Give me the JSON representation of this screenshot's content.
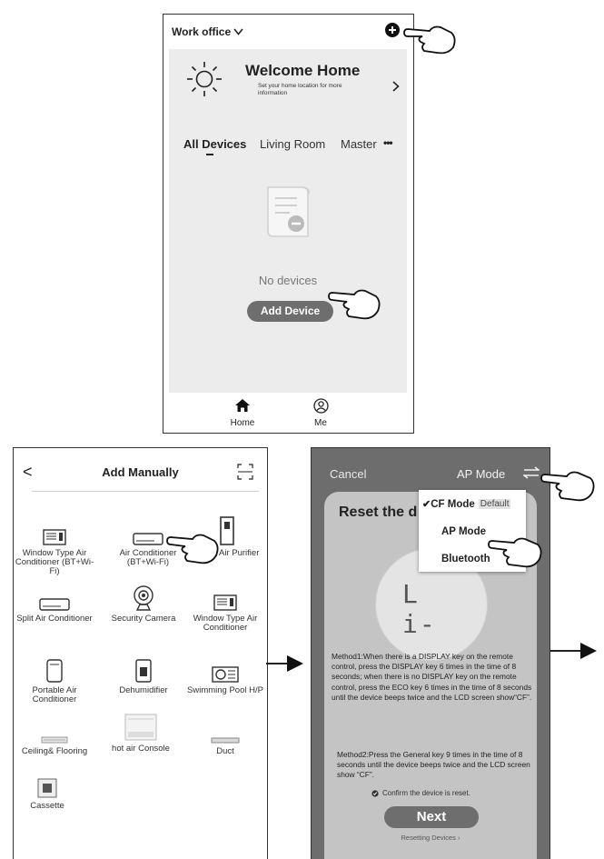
{
  "top_screen": {
    "location_label": "Work office",
    "welcome_title": "Welcome Home",
    "welcome_sub": "Set your home location for more information",
    "tabs": [
      "All Devices",
      "Living Room",
      "Master"
    ],
    "tab_more": "•••",
    "empty_text": "No devices",
    "add_device_label": "Add Device",
    "tabbar": [
      {
        "label": "Home",
        "icon": "home-icon"
      },
      {
        "label": "Me",
        "icon": "person-icon"
      }
    ]
  },
  "left_screen": {
    "back_glyph": "<",
    "title": "Add Manually",
    "devices": [
      {
        "label": "Window Type Air Conditioner (BT+Wi-Fi)",
        "icon": "window-ac-icon"
      },
      {
        "label": "Air Conditioner (BT+Wi-Fi)",
        "icon": "split-ac-icon"
      },
      {
        "label": "Fresh Air Purifier",
        "icon": "fresh-air-purifier-icon"
      },
      {
        "label": "Split Air Conditioner",
        "icon": "split-ac-icon"
      },
      {
        "label": "Security Camera",
        "icon": "camera-icon"
      },
      {
        "label": "Window Type Air Conditioner",
        "icon": "window-ac-icon"
      },
      {
        "label": "Portable Air Conditioner",
        "icon": "portable-ac-icon"
      },
      {
        "label": "Dehumidifier",
        "icon": "dehumidifier-icon"
      },
      {
        "label": "Swimming Pool H/P",
        "icon": "pool-heatpump-icon"
      },
      {
        "label": "Ceiling& Flooring",
        "icon": "ceiling-unit-icon"
      },
      {
        "label": "hot air Console",
        "icon": "console-icon"
      },
      {
        "label": "Duct",
        "icon": "duct-icon"
      },
      {
        "label": "Cassette",
        "icon": "cassette-icon"
      }
    ]
  },
  "right_screen": {
    "cancel_label": "Cancel",
    "mode_label": "AP Mode",
    "dialog_title": "Reset the d",
    "menu": {
      "cf_check": "✔",
      "cf_mode": "CF Mode",
      "default_badge": "Default",
      "ap_mode": "AP Mode",
      "bluetooth": "Bluetooth"
    },
    "display_glyph": "L i-",
    "method1": "Method1:When there is a DISPLAY key on the remote control, press the DISPLAY key 6 times in the time of 8 seconds; when there is no DISPLAY key on the remote control, press the ECO key 6 times in the time of 8 seconds until the device beeps twice and the LCD screen show“CF”.",
    "method2": "Method2:Press the General key 9 times in the time of 8 seconds until the device beeps twice and the LCD screen show “CF”.",
    "confirm_text": "Confirm the device is reset.",
    "next_label": "Next",
    "resetting_link": "Resetting Devices ›"
  },
  "colors": {
    "card_bg": "#ececec",
    "pill": "#6e6e6e",
    "overlay": "#6d6d6d",
    "dialog_bg": "#c4c4c4"
  }
}
